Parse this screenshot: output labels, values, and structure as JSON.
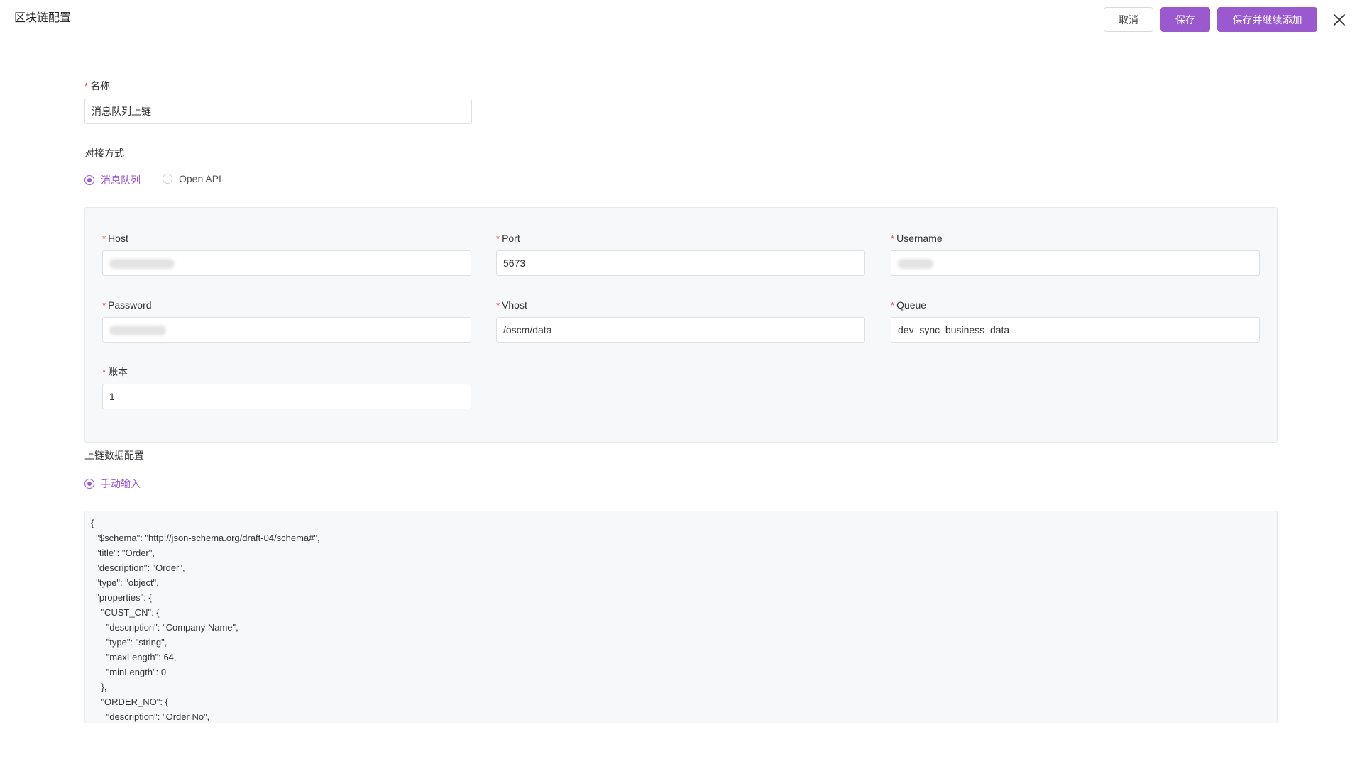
{
  "header": {
    "title": "区块链配置",
    "cancel_label": "取消",
    "save_label": "保存",
    "save_add_label": "保存并继续添加",
    "close_icon": "close-icon"
  },
  "form": {
    "name": {
      "label": "名称",
      "value": "消息队列上链"
    },
    "integration": {
      "label": "对接方式",
      "options": [
        "消息队列",
        "Open API"
      ],
      "selected": "消息队列"
    },
    "mq": {
      "host": {
        "label": "Host",
        "value": ""
      },
      "port": {
        "label": "Port",
        "value": "5673"
      },
      "username": {
        "label": "Username",
        "value": ""
      },
      "password": {
        "label": "Password",
        "value": ""
      },
      "vhost": {
        "label": "Vhost",
        "value": "/oscm/data"
      },
      "queue": {
        "label": "Queue",
        "value": "dev_sync_business_data"
      },
      "ledger": {
        "label": "账本",
        "value": "1"
      }
    },
    "data_config": {
      "label": "上链数据配置",
      "options": [
        "手动输入"
      ],
      "selected": "手动输入"
    },
    "schema_lines": [
      "{",
      "  \"$schema\": \"http://json-schema.org/draft-04/schema#\",",
      "  \"title\": \"Order\",",
      "  \"description\": \"Order\",",
      "  \"type\": \"object\",",
      "  \"properties\": {",
      "    \"CUST_CN\": {",
      "      \"description\": \"Company Name\",",
      "      \"type\": \"string\",",
      "      \"maxLength\": 64,",
      "      \"minLength\": 0",
      "    },",
      "    \"ORDER_NO\": {",
      "      \"description\": \"Order No\","
    ]
  },
  "colors": {
    "accent": "#9b59cf",
    "required": "#e5484d",
    "panel_bg": "#f7f8fa"
  }
}
